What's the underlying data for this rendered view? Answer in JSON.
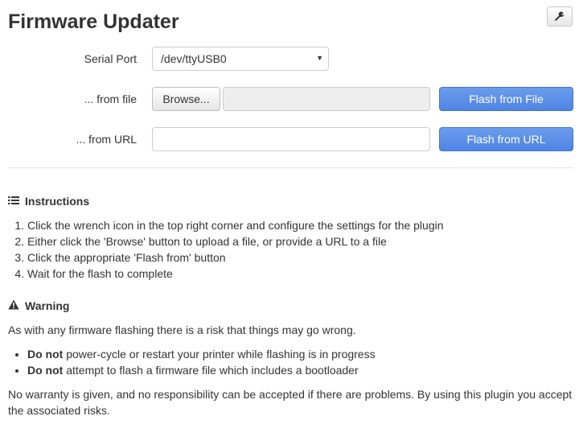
{
  "header": {
    "title": "Firmware Updater",
    "settings_icon": "wrench-icon"
  },
  "form": {
    "serial_port_label": "Serial Port",
    "serial_port_value": "/dev/ttyUSB0",
    "from_file_label": "... from file",
    "browse_label": "Browse...",
    "file_value": "",
    "flash_file_label": "Flash from File",
    "from_url_label": "... from URL",
    "url_value": "",
    "flash_url_label": "Flash from URL"
  },
  "instructions": {
    "heading": "Instructions",
    "icon": "list-icon",
    "steps": [
      "Click the wrench icon in the top right corner and configure the settings for the plugin",
      "Either click the 'Browse' button to upload a file, or provide a URL to a file",
      "Click the appropriate 'Flash from' button",
      "Wait for the flash to complete"
    ]
  },
  "warning": {
    "heading": "Warning",
    "icon": "warning-icon",
    "intro": "As with any firmware flashing there is a risk that things may go wrong.",
    "items": [
      {
        "bold": "Do not",
        "text": " power-cycle or restart your printer while flashing is in progress"
      },
      {
        "bold": "Do not",
        "text": " attempt to flash a firmware file which includes a bootloader"
      }
    ],
    "disclaimer": "No warranty is given, and no responsibility can be accepted if there are problems. By using this plugin you accept the associated risks."
  },
  "colors": {
    "primary": "#5b8fe8",
    "text": "#333333"
  }
}
